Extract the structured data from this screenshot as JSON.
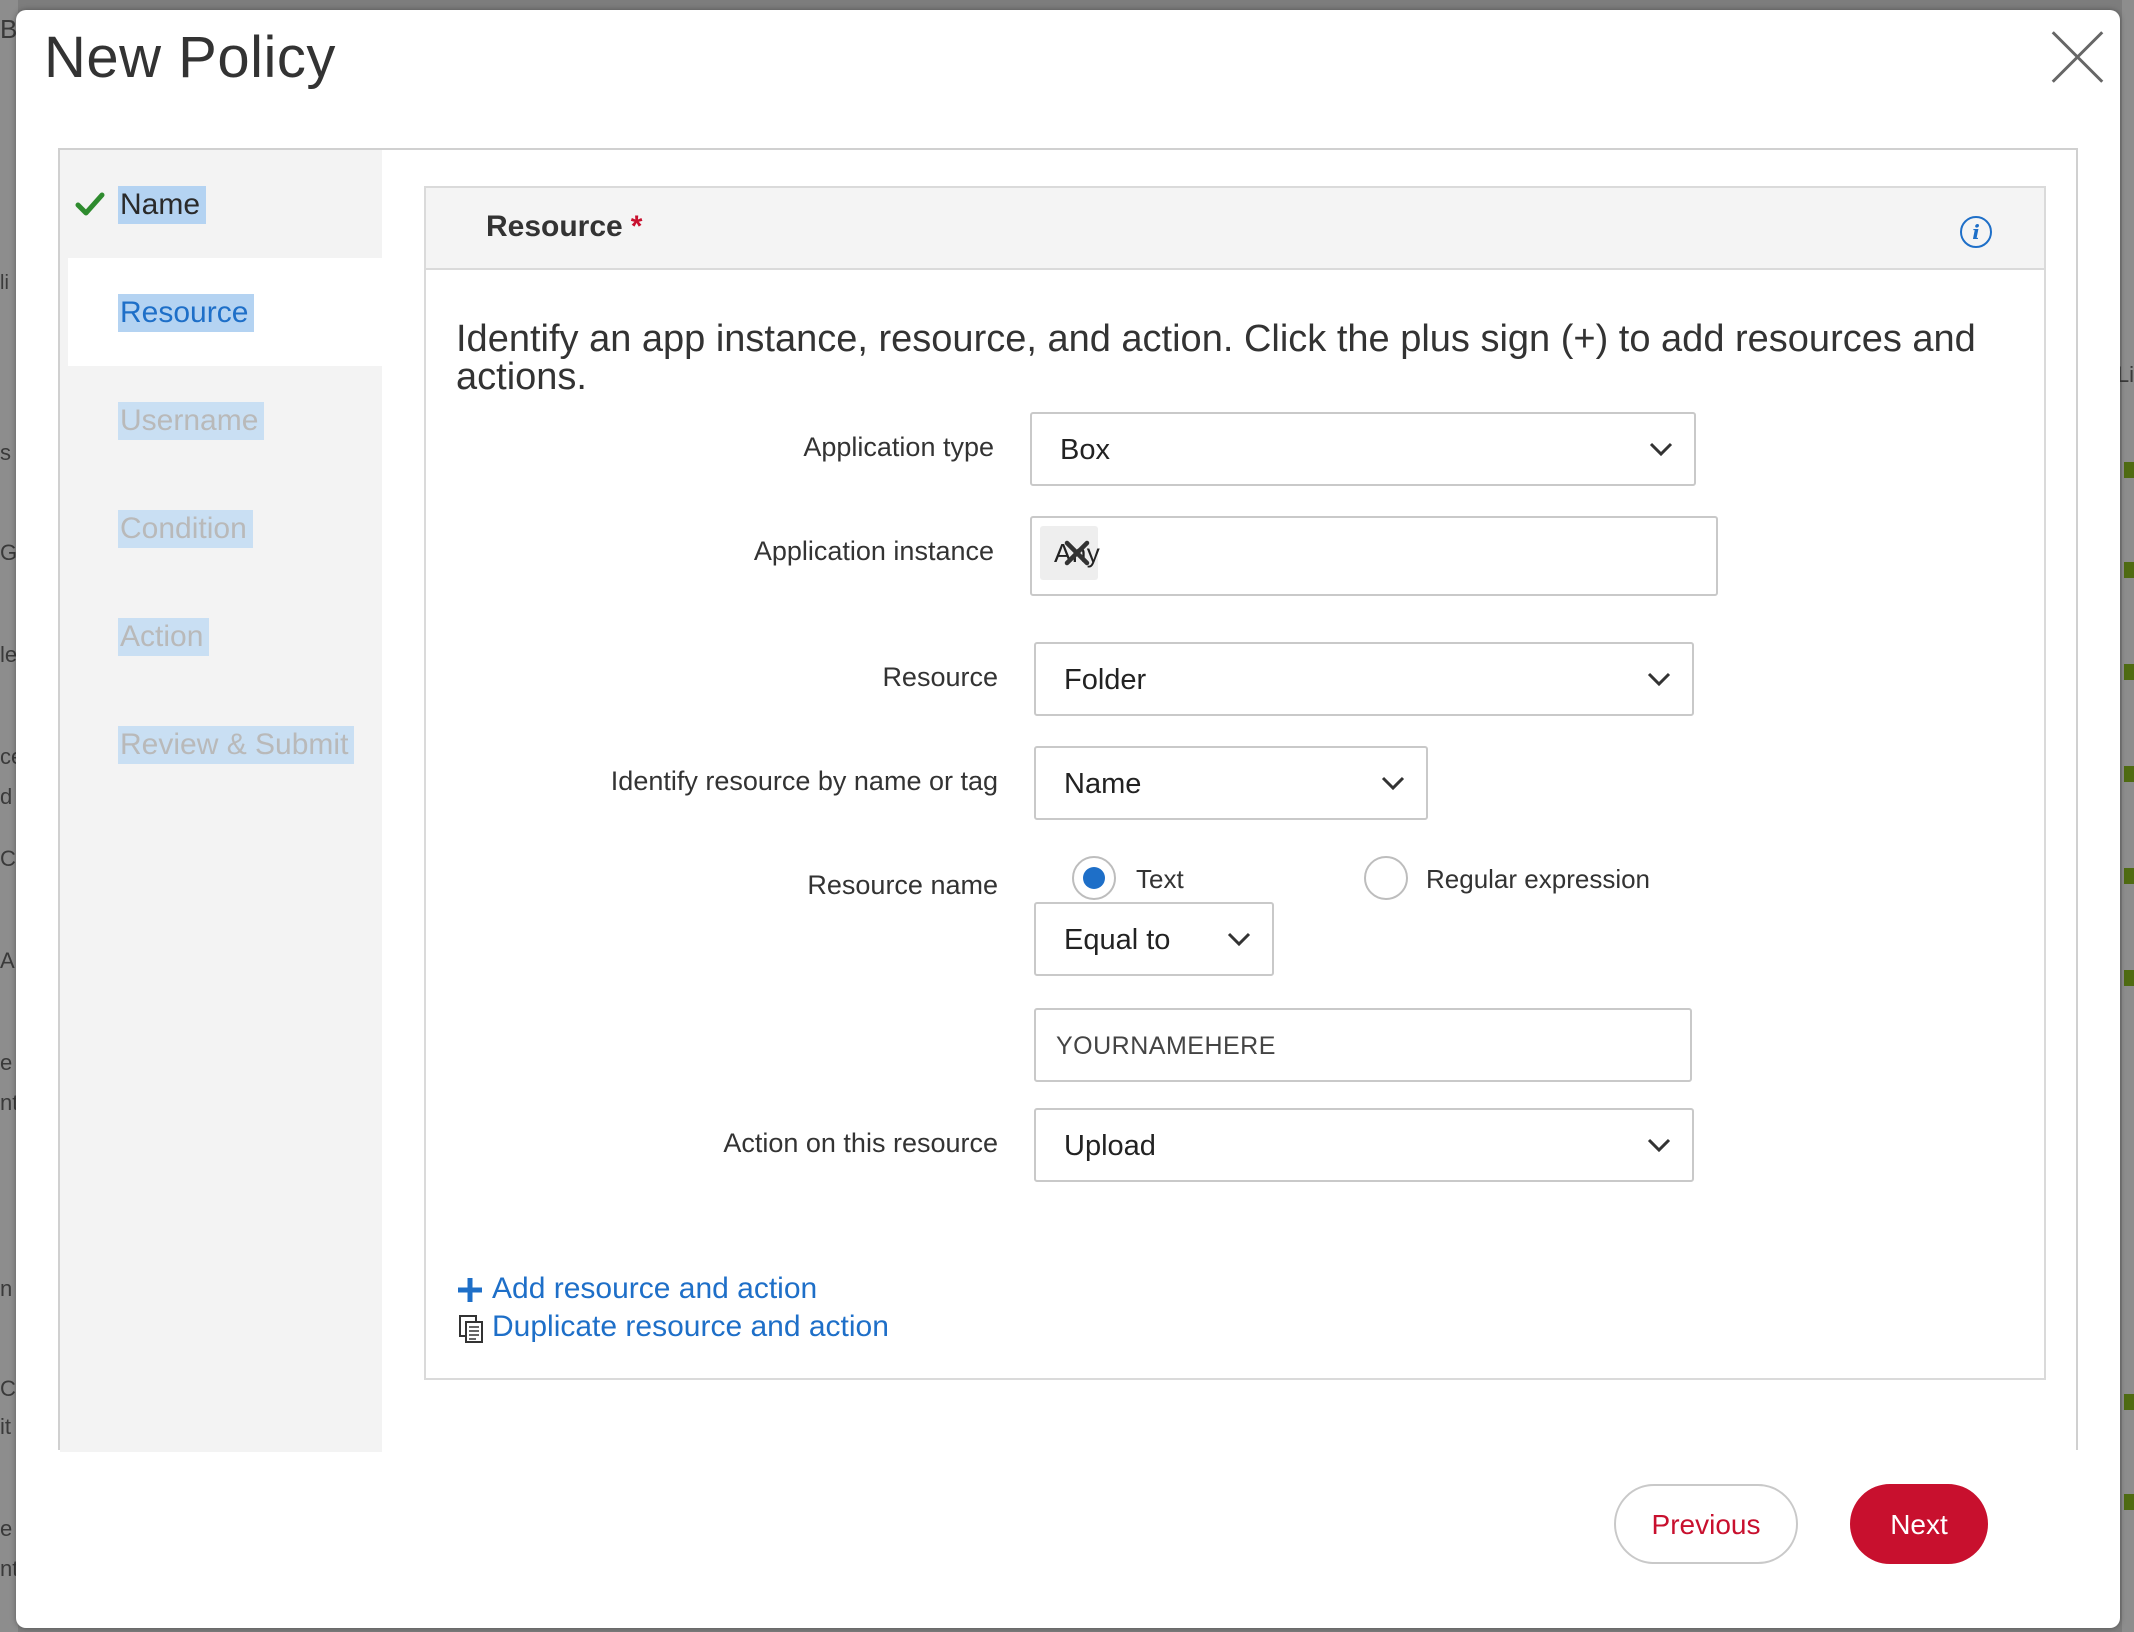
{
  "modal": {
    "title": "New Policy"
  },
  "steps": [
    {
      "label": "Name",
      "state": "done"
    },
    {
      "label": "Resource",
      "state": "active"
    },
    {
      "label": "Username",
      "state": "pending"
    },
    {
      "label": "Condition",
      "state": "pending"
    },
    {
      "label": "Action",
      "state": "pending"
    },
    {
      "label": "Review & Submit",
      "state": "pending"
    }
  ],
  "panel": {
    "title": "Resource",
    "required_marker": "*",
    "intro": "Identify an app instance, resource, and action. Click the plus sign (+) to add resources and actions."
  },
  "form": {
    "application_type": {
      "label": "Application type",
      "value": "Box"
    },
    "application_instance": {
      "label": "Application instance",
      "chip": "Any"
    },
    "resource": {
      "label": "Resource",
      "value": "Folder"
    },
    "identify_by": {
      "label": "Identify resource by name or tag",
      "value": "Name"
    },
    "resource_name": {
      "label": "Resource name",
      "options": [
        "Text",
        "Regular expression"
      ],
      "selected": "Text",
      "operator": "Equal to",
      "value": "YOURNAMEHERE"
    },
    "action": {
      "label": "Action on this resource",
      "value": "Upload"
    }
  },
  "links": {
    "add": "Add resource and action",
    "duplicate": "Duplicate resource and action"
  },
  "buttons": {
    "previous": "Previous",
    "next": "Next"
  },
  "colors": {
    "accent_blue": "#1e6fc8",
    "brand_red": "#c8102e",
    "check_green": "#2e8b2e",
    "selection_highlight": "#b4d3f2"
  },
  "backdrop": {
    "letters": [
      "B",
      "li",
      "s I",
      "Gr",
      "le",
      "ce",
      "d",
      "C",
      "A",
      "e",
      "nt",
      "n",
      "C",
      "it",
      "e",
      "nt",
      "Li"
    ]
  }
}
